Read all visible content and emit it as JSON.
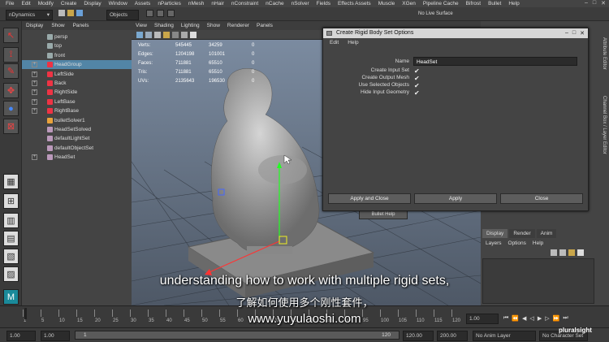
{
  "menubar": [
    "File",
    "Edit",
    "Modify",
    "Create",
    "Display",
    "Window",
    "Assets",
    "nParticles",
    "nMesh",
    "nHair",
    "nConstraint",
    "nCache",
    "nSolver",
    "Fields",
    "Effects Assets",
    "Muscle",
    "XGen",
    "Pipeline Cache",
    "Bifrost",
    "Bullet",
    "Help"
  ],
  "shelf": {
    "mode": "nDynamics",
    "selection_mode": "Objects",
    "live_surface": "No Live Surface"
  },
  "outliner": {
    "menu": [
      "Display",
      "Show",
      "Panels"
    ],
    "items": [
      {
        "label": "persp",
        "icon": "camera-icon",
        "expand": false,
        "selected": false
      },
      {
        "label": "top",
        "icon": "camera-icon",
        "expand": false,
        "selected": false
      },
      {
        "label": "front",
        "icon": "camera-icon",
        "expand": false,
        "selected": false
      },
      {
        "label": "HeadGroup",
        "icon": "group-icon",
        "expand": true,
        "selected": true
      },
      {
        "label": "LeftSide",
        "icon": "group-icon",
        "expand": true,
        "selected": false
      },
      {
        "label": "Back",
        "icon": "group-icon",
        "expand": true,
        "selected": false
      },
      {
        "label": "RightSide",
        "icon": "group-icon",
        "expand": true,
        "selected": false
      },
      {
        "label": "LeftBase",
        "icon": "group-icon",
        "expand": true,
        "selected": false
      },
      {
        "label": "RightBase",
        "icon": "group-icon",
        "expand": true,
        "selected": false
      },
      {
        "label": "bulletSolver1",
        "icon": "solver-icon",
        "expand": false,
        "selected": false
      },
      {
        "label": "HeadSetSolved",
        "icon": "set-icon",
        "expand": false,
        "selected": false
      },
      {
        "label": "defaultLightSet",
        "icon": "set-icon",
        "expand": false,
        "selected": false
      },
      {
        "label": "defaultObjectSet",
        "icon": "set-icon",
        "expand": false,
        "selected": false
      },
      {
        "label": "HeadSet",
        "icon": "set-icon",
        "expand": true,
        "selected": false
      }
    ]
  },
  "viewport": {
    "menu": [
      "View",
      "Shading",
      "Lighting",
      "Show",
      "Renderer",
      "Panels"
    ],
    "hud": [
      {
        "label": "Verts:",
        "a": "545445",
        "b": "34259",
        "c": "0"
      },
      {
        "label": "Edges:",
        "a": "1204198",
        "b": "101001",
        "c": "0"
      },
      {
        "label": "Faces:",
        "a": "711881",
        "b": "65510",
        "c": "0"
      },
      {
        "label": "Tris:",
        "a": "711881",
        "b": "65510",
        "c": "0"
      },
      {
        "label": "UVs:",
        "a": "2135643",
        "b": "196530",
        "c": "0"
      }
    ],
    "bullet_help": "Bullet Help"
  },
  "dialog": {
    "title": "Create Rigid Body Set Options",
    "menu": [
      "Edit",
      "Help"
    ],
    "name_label": "Name",
    "name_value": "HeadSet",
    "options": [
      "Create Input Set",
      "Create Output Mesh",
      "Use Selected Objects",
      "Hide Input Geometry"
    ],
    "buttons": {
      "apply_close": "Apply and Close",
      "apply": "Apply",
      "close": "Close"
    }
  },
  "right_panel": {
    "tabs": [
      "Display",
      "Render",
      "Anim"
    ],
    "menu": [
      "Layers",
      "Options",
      "Help"
    ],
    "side_tabs": [
      "Attribute Editor",
      "Channel Box / Layer Editor"
    ]
  },
  "timeline": {
    "ticks": [
      "1",
      "5",
      "10",
      "15",
      "20",
      "25",
      "30",
      "35",
      "40",
      "45",
      "50",
      "55",
      "60",
      "65",
      "70",
      "75",
      "80",
      "85",
      "90",
      "95",
      "100",
      "105",
      "110",
      "115",
      "120"
    ],
    "current": "1.00"
  },
  "range": {
    "start": "1.00",
    "start2": "1.00",
    "slider_start": "1",
    "slider_end": "120",
    "end": "120.00",
    "end2": "200.00",
    "anim_layer": "No Anim Layer",
    "char_set": "No Character Set",
    "watermark": "pluralsight"
  },
  "subtitles": {
    "en": "understanding how to work with multiple rigid sets,",
    "zh": "了解如何使用多个刚性套件，",
    "url": "www.yuyulaoshi.com"
  }
}
